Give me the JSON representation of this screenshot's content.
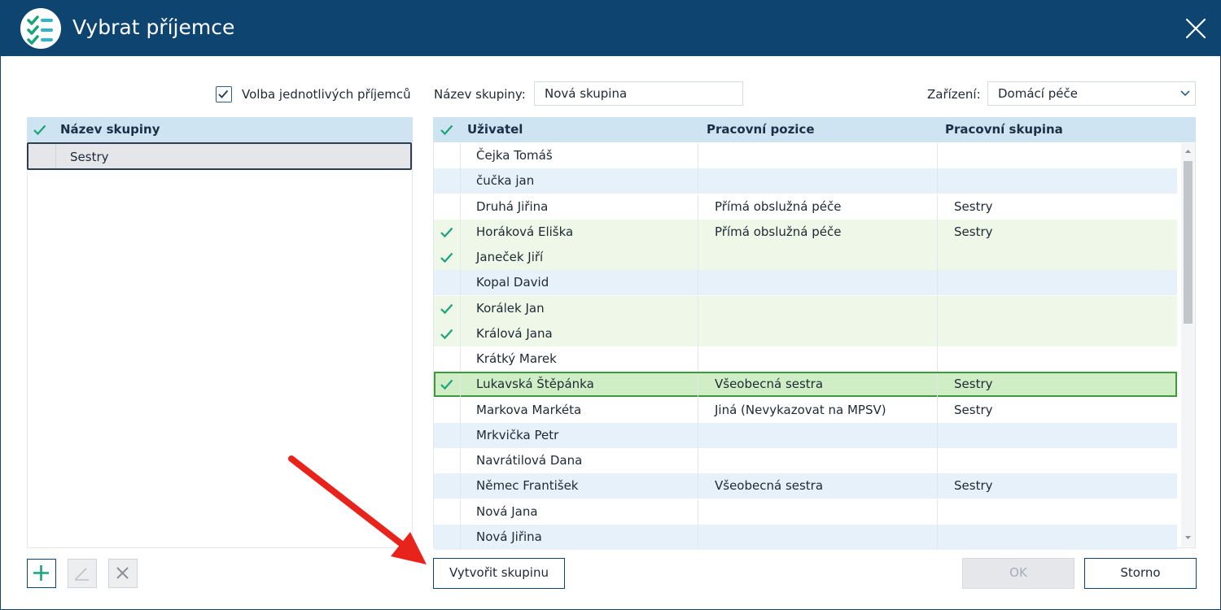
{
  "window": {
    "title": "Vybrat příjemce",
    "icon": "app-checklist-icon",
    "close_icon": "close-icon"
  },
  "left_panel": {
    "individual_recipients_checkbox": {
      "label": "Volba jednotlivých příjemců",
      "checked": true
    },
    "groups_table": {
      "column_header": "Název skupiny",
      "rows": [
        {
          "name": "Sestry",
          "selected": true
        }
      ]
    },
    "buttons": [
      {
        "icon": "plus-icon",
        "enabled": true
      },
      {
        "icon": "edit-pencil-icon",
        "enabled": false
      },
      {
        "icon": "delete-x-icon",
        "enabled": false
      }
    ]
  },
  "right_panel": {
    "group_name": {
      "label": "Název skupiny:",
      "value": "Nová skupina"
    },
    "facility": {
      "label": "Zařízení:",
      "value": "Domácí péče"
    },
    "users_table": {
      "columns": [
        "Uživatel",
        "Pracovní pozice",
        "Pracovní skupina"
      ],
      "rows": [
        {
          "user": "Čejka Tomáš",
          "position": "",
          "group": "",
          "checked": false
        },
        {
          "user": "čučka jan",
          "position": "",
          "group": "",
          "checked": false
        },
        {
          "user": "Druhá Jiřina",
          "position": "Přímá obslužná péče",
          "group": "Sestry",
          "checked": false
        },
        {
          "user": "Horáková Eliška",
          "position": "Přímá obslužná péče",
          "group": "Sestry",
          "checked": true
        },
        {
          "user": "Janeček Jiří",
          "position": "",
          "group": "",
          "checked": true
        },
        {
          "user": "Kopal David",
          "position": "",
          "group": "",
          "checked": false
        },
        {
          "user": "Korálek Jan",
          "position": "",
          "group": "",
          "checked": true
        },
        {
          "user": "Králová Jana",
          "position": "",
          "group": "",
          "checked": true
        },
        {
          "user": "Krátký Marek",
          "position": "",
          "group": "",
          "checked": false
        },
        {
          "user": "Lukavská Štěpánka",
          "position": "Všeobecná sestra",
          "group": "Sestry",
          "checked": true,
          "selected": true
        },
        {
          "user": "Markova Markéta",
          "position": "Jiná (Nevykazovat na MPSV)",
          "group": "Sestry",
          "checked": false
        },
        {
          "user": "Mrkvička Petr",
          "position": "",
          "group": "",
          "checked": false
        },
        {
          "user": "Navrátilová Dana",
          "position": "",
          "group": "",
          "checked": false
        },
        {
          "user": "Němec František",
          "position": "Všeobecná sestra",
          "group": "Sestry",
          "checked": false
        },
        {
          "user": "Nová Jana",
          "position": "",
          "group": "",
          "checked": false
        },
        {
          "user": "Nová Jiřina",
          "position": "",
          "group": "",
          "checked": false
        }
      ]
    },
    "create_group_button": "Vytvořit skupinu"
  },
  "footer": {
    "ok_label": "OK",
    "ok_enabled": false,
    "cancel_label": "Storno"
  },
  "colors": {
    "titlebar": "#0d4470",
    "header_bg": "#cfe4f2",
    "check_accent": "#1aa37a",
    "selected_row": "#cfeec6",
    "selected_border": "#3d9a3a",
    "annotation_arrow": "#e8231b"
  },
  "annotation": {
    "icon": "red-arrow-pointer",
    "target": "create-group-button"
  }
}
